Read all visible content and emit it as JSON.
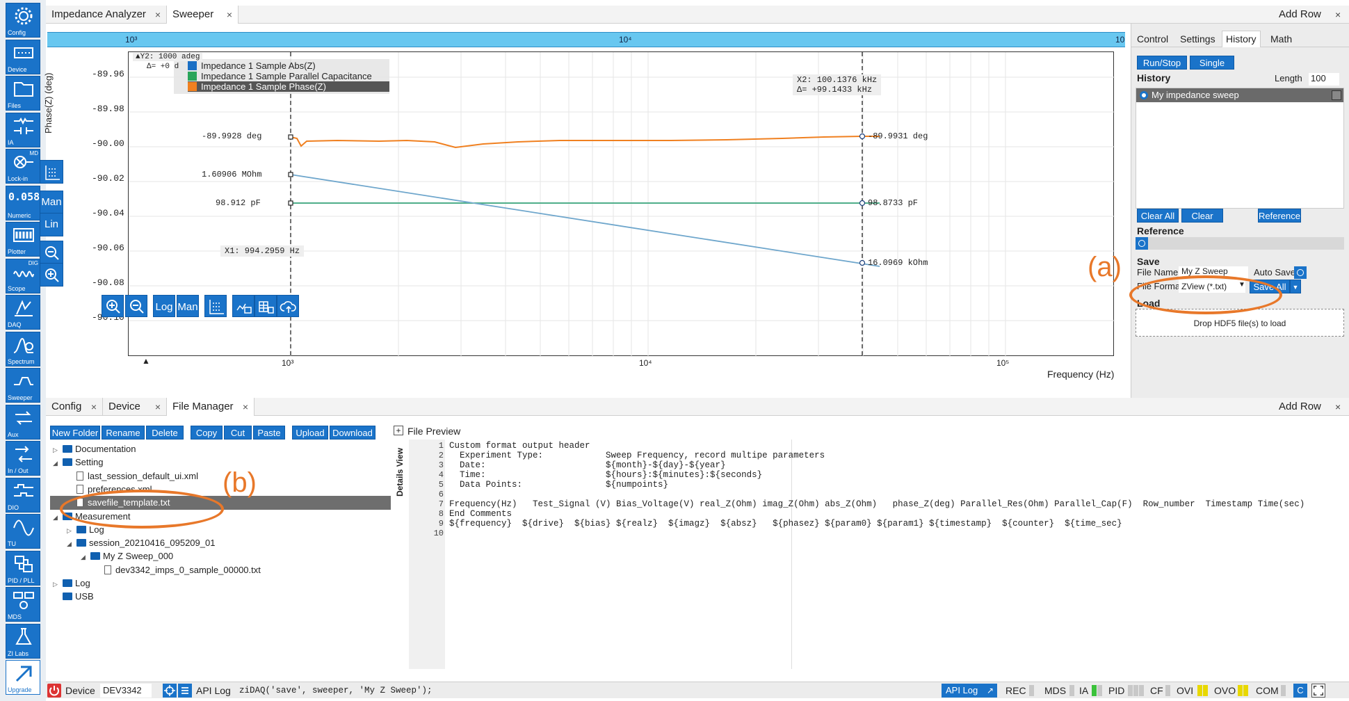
{
  "sidebar": [
    {
      "label": "Config",
      "icon": "gear-icon"
    },
    {
      "label": "Device",
      "icon": "device-icon"
    },
    {
      "label": "Files",
      "icon": "folder-icon"
    },
    {
      "label": "IA",
      "icon": "impedance-icon"
    },
    {
      "label": "Lock-in",
      "icon": "lockin-icon",
      "mini": "MD"
    },
    {
      "label": "Numeric",
      "icon": "numeric-icon",
      "glyph": "0.058"
    },
    {
      "label": "Plotter",
      "icon": "plotter-icon"
    },
    {
      "label": "Scope",
      "icon": "scope-icon",
      "mini": "DIG"
    },
    {
      "label": "DAQ",
      "icon": "daq-icon"
    },
    {
      "label": "Spectrum",
      "icon": "spectrum-icon"
    },
    {
      "label": "Sweeper",
      "icon": "sweeper-icon"
    },
    {
      "label": "Aux",
      "icon": "aux-icon"
    },
    {
      "label": "In / Out",
      "icon": "inout-icon"
    },
    {
      "label": "DIO",
      "icon": "dio-icon"
    },
    {
      "label": "TU",
      "icon": "tu-icon"
    },
    {
      "label": "PID / PLL",
      "icon": "pid-icon"
    },
    {
      "label": "MDS",
      "icon": "mds-icon"
    },
    {
      "label": "ZI Labs",
      "icon": "flask-icon"
    },
    {
      "label": "Upgrade",
      "icon": "upgrade-icon"
    }
  ],
  "top_tabs": {
    "tab1": "Impedance Analyzer",
    "tab2": "Sweeper",
    "add_row": "Add Row",
    "close": "×"
  },
  "plot": {
    "top_axis": {
      "t1": "10³",
      "t2": "10⁴",
      "t3": "10"
    },
    "yaxis_label": "Phase(Z) (deg)",
    "xaxis_label": "Frequency (Hz)",
    "yticks": [
      "-89.96",
      "-89.98",
      "-90.00",
      "-90.02",
      "-90.04",
      "-90.06",
      "-90.08",
      "-90.10"
    ],
    "xticks": [
      "10³",
      "10⁴",
      "10⁵"
    ],
    "y2_cursor": "▲Y2: 1000 adeg",
    "y2_delta": "Δ= +0 d",
    "x2_cursor": "X2: 100.1376 kHz",
    "x2_delta": "Δ= +99.1433 kHz",
    "x1_cursor": "X1: 994.2959 Hz",
    "legend": [
      "Impedance 1 Sample Abs(Z)",
      "Impedance 1 Sample Parallel Capacitance",
      "Impedance 1 Sample Phase(Z)"
    ],
    "legend_colors": [
      "#1a6fc4",
      "#2aa55a",
      "#f08020"
    ],
    "markers_left": [
      "-89.9928 deg",
      "1.60906 MOhm",
      "98.912 pF"
    ],
    "markers_right": [
      "-89.9931 deg",
      "98.8733 pF",
      "16.0969 kOhm"
    ],
    "side_buttons": {
      "man": "Man",
      "lin": "Lin"
    },
    "bottom_buttons": {
      "log": "Log",
      "man": "Man"
    }
  },
  "right_panel": {
    "tabs": [
      "Control",
      "Settings",
      "History",
      "Math"
    ],
    "run_stop": "Run/Stop",
    "single": "Single",
    "history_label": "History",
    "length_label": "Length",
    "length_value": "100",
    "history_item": "My impedance sweep",
    "clear_all": "Clear All",
    "clear": "Clear",
    "reference_btn": "Reference",
    "reference_label": "Reference",
    "save_label": "Save",
    "file_name_label": "File Name",
    "file_name_value": "My Z Sweep",
    "auto_save": "Auto Save",
    "file_format_label": "File Format",
    "file_format_value": "ZView (*.txt)",
    "save_all": "Save All",
    "load_label": "Load",
    "drop_text": "Drop HDF5 file(s) to load"
  },
  "annotations": {
    "a": "(a)",
    "b": "(b)",
    "color": "#e8782a"
  },
  "bottom_tabs": {
    "tab1": "Config",
    "tab2": "Device",
    "tab3": "File Manager",
    "add_row": "Add Row",
    "close": "×"
  },
  "file_toolbar": [
    "New Folder",
    "Rename",
    "Delete",
    "Copy",
    "Cut",
    "Paste",
    "Upload",
    "Download"
  ],
  "file_tree": [
    {
      "name": "Documentation",
      "type": "folder",
      "level": 0,
      "arrow": "▷"
    },
    {
      "name": "Setting",
      "type": "folder",
      "level": 0,
      "arrow": "◢"
    },
    {
      "name": "last_session_default_ui.xml",
      "type": "file",
      "level": 1
    },
    {
      "name": "preferences.xml",
      "type": "file",
      "level": 1
    },
    {
      "name": "savefile_template.txt",
      "type": "file",
      "level": 1,
      "selected": true
    },
    {
      "name": "Measurement",
      "type": "folder",
      "level": 0,
      "arrow": "◢"
    },
    {
      "name": "Log",
      "type": "folder",
      "level": 1,
      "arrow": "▷"
    },
    {
      "name": "session_20210416_095209_01",
      "type": "folder",
      "level": 1,
      "arrow": "◢"
    },
    {
      "name": "My Z Sweep_000",
      "type": "folder",
      "level": 2,
      "arrow": "◢"
    },
    {
      "name": "dev3342_imps_0_sample_00000.txt",
      "type": "file",
      "level": 3
    },
    {
      "name": "Log",
      "type": "folder",
      "level": 0,
      "arrow": "▷"
    },
    {
      "name": "USB",
      "type": "folder",
      "level": 0
    }
  ],
  "preview": {
    "plus": "+",
    "title": "File Preview",
    "details": "Details View",
    "lines": [
      "Custom format output header",
      "  Experiment Type:            Sweep Frequency, record multipe parameters",
      "  Date:                       ${month}-${day}-${year}",
      "  Time:                       ${hours}:${minutes}:${seconds}",
      "  Data Points:                ${numpoints}",
      "",
      "Frequency(Hz)   Test_Signal (V) Bias_Voltage(V) real_Z(Ohm) imag_Z(Ohm) abs_Z(Ohm)   phase_Z(deg) Parallel_Res(Ohm) Parallel_Cap(F)  Row_number  Timestamp Time(sec)",
      "End Comments",
      "${frequency}  ${drive}  ${bias} ${realz}  ${imagz}  ${absz}   ${phasez} ${param0} ${param1} ${timestamp}  ${counter}  ${time_sec}",
      ""
    ]
  },
  "statusbar": {
    "device_label": "Device",
    "device_value": "DEV3342",
    "api_label": "API Log",
    "api_cmd": "ziDAQ('save', sweeper, 'My Z Sweep');",
    "api_log_btn": "API Log",
    "indicators": [
      "REC",
      "MDS",
      "IA",
      "PID",
      "CF",
      "OVI",
      "OVO",
      "COM"
    ],
    "c_btn": "C"
  }
}
